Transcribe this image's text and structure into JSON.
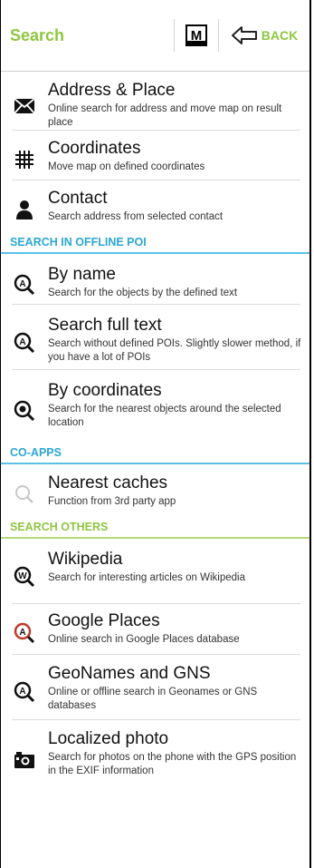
{
  "header": {
    "title": "Search",
    "map_letter": "M",
    "back_label": "BACK"
  },
  "items_top": [
    {
      "title": "Address & Place",
      "subtitle": "Online search for address and move map on result place",
      "icon": "envelope-icon"
    },
    {
      "title": "Coordinates",
      "subtitle": "Move map on defined coordinates",
      "icon": "grid-hash-icon"
    },
    {
      "title": "Contact",
      "subtitle": "Search address from selected contact",
      "icon": "person-icon"
    }
  ],
  "section_offline": "SEARCH IN OFFLINE POI",
  "items_offline": [
    {
      "title": "By name",
      "subtitle": "Search for the objects by the defined text",
      "icon": "search-a-icon"
    },
    {
      "title": "Search full text",
      "subtitle": "Search without defined POIs. Slightly slower method, if you have a lot of POIs",
      "icon": "search-a-icon"
    },
    {
      "title": "By coordinates",
      "subtitle": "Search for the nearest objects around the selected location",
      "icon": "search-target-icon"
    }
  ],
  "section_coapps": "CO-APPS",
  "items_coapps": [
    {
      "title": "Nearest caches",
      "subtitle": "Function from 3rd party app",
      "icon": "magnifier-icon"
    }
  ],
  "section_others": "SEARCH OTHERS",
  "items_others": [
    {
      "title": "Wikipedia",
      "subtitle": "Search for interesting articles on Wikipedia",
      "icon": "search-w-icon"
    },
    {
      "title": "Google Places",
      "subtitle": "Online search in Google Places database",
      "icon": "search-a-red-icon"
    },
    {
      "title": "GeoNames and GNS",
      "subtitle": "Online or offline search in Geonames or GNS databases",
      "icon": "search-a-icon"
    },
    {
      "title": "Localized photo",
      "subtitle": "Search for photos on the phone with the GPS position in the EXIF information",
      "icon": "camera-icon"
    }
  ],
  "colors": {
    "accent_green": "#8ec63f",
    "accent_blue": "#2aa7d4"
  }
}
